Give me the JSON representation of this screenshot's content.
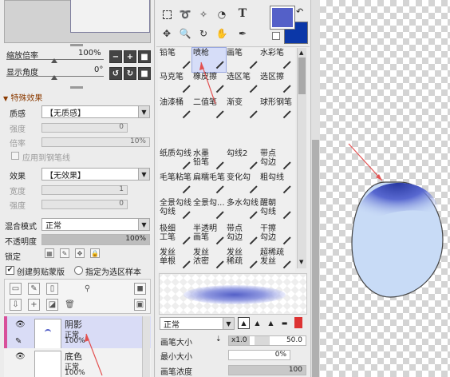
{
  "left": {
    "zoom": {
      "label": "缩放倍率",
      "value": "100%"
    },
    "angle": {
      "label": "显示角度",
      "value": "0°"
    },
    "special": {
      "title": "特殊效果",
      "texture": {
        "label": "质感",
        "value": "【无质感】"
      },
      "strength": {
        "label": "强度",
        "value": "0"
      },
      "scale": {
        "label": "倍率",
        "value": "10%"
      },
      "apply_pen": "应用到钢笔线",
      "effect": {
        "label": "效果",
        "value": "【无效果】"
      },
      "width": {
        "label": "宽度",
        "value": "1"
      },
      "intensity": {
        "label": "强度",
        "value": "0"
      }
    },
    "blend": {
      "label": "混合模式",
      "value": "正常"
    },
    "opacity": {
      "label": "不透明度",
      "value": "100%"
    },
    "lock": {
      "label": "锁定"
    },
    "clip_label": "创建剪贴蒙版",
    "selection_label": "指定为选区样本",
    "layers": [
      {
        "name": "阴影",
        "mode": "正常",
        "opacity": "100%"
      },
      {
        "name": "底色",
        "mode": "正常",
        "opacity": "100%"
      }
    ]
  },
  "tools": {
    "text_tool": "T",
    "colors": {
      "primary": "#5460c8",
      "secondary": "#0b37a8"
    }
  },
  "brushes": [
    [
      "铅笔",
      "喷枪",
      "画笔",
      "水彩笔"
    ],
    [
      "马克笔",
      "橡皮擦",
      "选区笔",
      "选区擦"
    ],
    [
      "油漆桶",
      "二值笔",
      "渐变",
      "球形钢笔"
    ],
    [
      "",
      "",
      "",
      ""
    ],
    [
      "纸质勾线",
      "水墨\n铅笔",
      "勾线2",
      "带点\n勾边"
    ],
    [
      "毛笔粘笔",
      "扁糯毛笔",
      "变化勾",
      "粗勾线"
    ],
    [
      "全景勾线\n勾线",
      "全景勾...",
      "多水勾线",
      "醒朝\n勾线"
    ],
    [
      "极细\n工笔",
      "半透明\n画笔",
      "带点\n勾边",
      "干擦\n勾边"
    ],
    [
      "发丝\n单根",
      "发丝\n浓密",
      "发丝\n稀疏",
      "超稀疏\n发丝"
    ]
  ],
  "brush_settings": {
    "mode": "正常",
    "size": {
      "label": "画笔大小",
      "mult": "x1.0",
      "value": "50.0"
    },
    "min_size": {
      "label": "最小大小",
      "value": "0%"
    },
    "density": {
      "label": "画笔浓度",
      "value": "100"
    }
  }
}
